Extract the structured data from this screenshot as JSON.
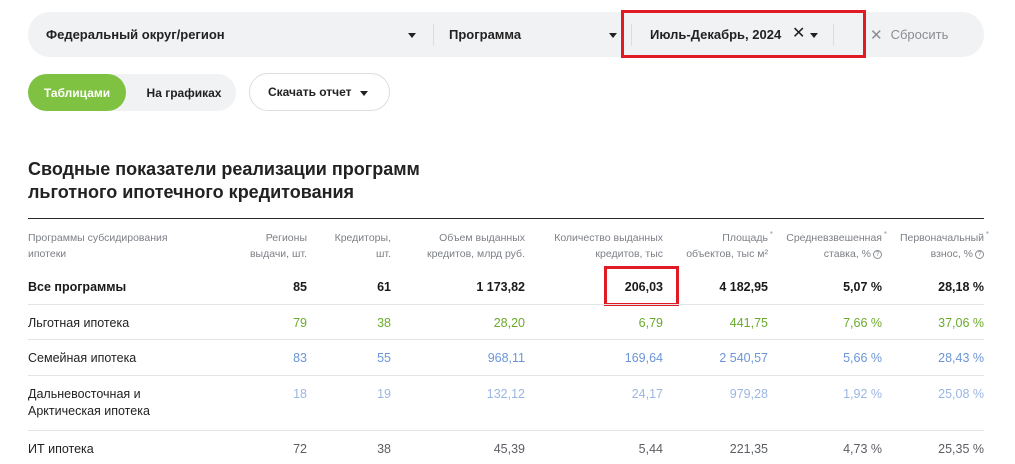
{
  "filters": {
    "region": "Федеральный округ/регион",
    "program": "Программа",
    "period": "Июль-Декабрь, 2024",
    "clear_icon": "close-icon",
    "reset": "Сбросить"
  },
  "view": {
    "tables": "Таблицами",
    "charts": "На графиках",
    "download": "Скачать отчет"
  },
  "section": {
    "title": "Сводные показатели реализации программ льготного ипотечного кредитования"
  },
  "table": {
    "headers": [
      {
        "l1": "Программы субсидирования",
        "l2": "ипотеки"
      },
      {
        "l1": "Регионы",
        "l2": "выдачи, шт."
      },
      {
        "l1": "Кредиторы,",
        "l2": "шт."
      },
      {
        "l1": "Объем выданных",
        "l2": "кредитов, млрд руб."
      },
      {
        "l1": "Количество выданных",
        "l2": "кредитов, тыс"
      },
      {
        "l1": "Площадь",
        "l2": "объектов, тыс м²"
      },
      {
        "l1": "Средневзвешенная",
        "l2": "ставка, %"
      },
      {
        "l1": "Первоначальный",
        "l2": "взнос, %"
      }
    ],
    "rows": [
      {
        "name": "Все программы",
        "name2": "",
        "regions": "85",
        "lenders": "61",
        "volume": "1 173,82",
        "count": "206,03",
        "area": "4 182,95",
        "rate": "5,07 %",
        "down": "28,18 %"
      },
      {
        "name": "Льготная ипотека",
        "name2": "",
        "regions": "79",
        "lenders": "38",
        "volume": "28,20",
        "count": "6,79",
        "area": "441,75",
        "rate": "7,66 %",
        "down": "37,06 %"
      },
      {
        "name": "Семейная ипотека",
        "name2": "",
        "regions": "83",
        "lenders": "55",
        "volume": "968,11",
        "count": "169,64",
        "area": "2 540,57",
        "rate": "5,66 %",
        "down": "28,43 %"
      },
      {
        "name": "Дальневосточная и",
        "name2": "Арктическая ипотека",
        "regions": "18",
        "lenders": "19",
        "volume": "132,12",
        "count": "24,17",
        "area": "979,28",
        "rate": "1,92 %",
        "down": "25,08 %"
      },
      {
        "name": "ИТ ипотека",
        "name2": "",
        "regions": "72",
        "lenders": "38",
        "volume": "45,39",
        "count": "5,44",
        "area": "221,35",
        "rate": "4,73 %",
        "down": "25,35 %"
      }
    ]
  },
  "colors": {
    "accent_green": "#7fc242",
    "highlight_red": "#e01b24",
    "value_green": "#6aab2b",
    "value_blue": "#6b95d8",
    "value_lightblue": "#9bb6e4"
  }
}
